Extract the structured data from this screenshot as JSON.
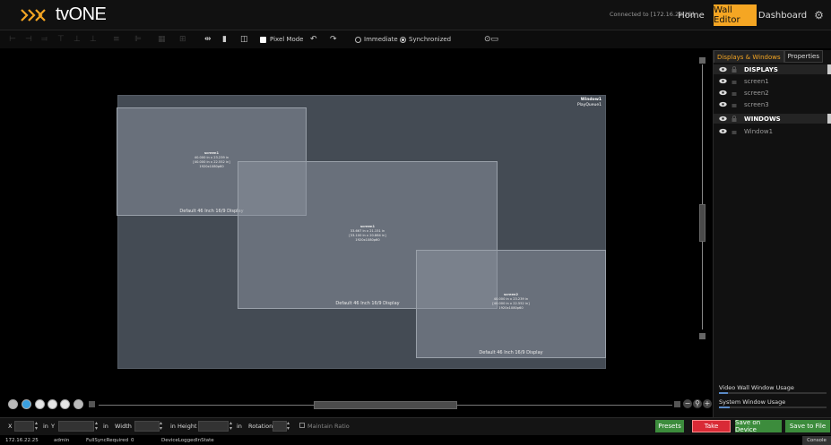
{
  "app": {
    "brand": "tvONE",
    "connection": "Connected to [172.16.22.25]"
  },
  "nav": {
    "home": "Home",
    "wall_editor": "Wall Editor",
    "dashboard": "Dashboard"
  },
  "toolbar": {
    "pixel_mode": "Pixel Mode",
    "immediate": "Immediate",
    "synchronized": "Synchronized",
    "selected_mode": "Synchronized"
  },
  "wall": {
    "window_title": "Window1",
    "window_sub": "PlayQueue1",
    "screens": [
      {
        "name": "screen1",
        "dims": "40.000 in x 23.239 in",
        "dims2": "[40.000 in x 22.552 in]",
        "res": "1920x1080p60",
        "footer": "Default 46 Inch 16/9 Display"
      },
      {
        "name": "screen1",
        "dims": "33.667 in x 21.151 in",
        "dims2": "[33.100 in x 20.864 in]",
        "res": "1920x1080p60",
        "footer": "Default 46 Inch 16/9 Display"
      },
      {
        "name": "screen2",
        "dims": "40.000 in x 23.239 in",
        "dims2": "[40.000 in x 22.552 in]",
        "res": "1920x1080p60",
        "footer": "Default 46 Inch 16/9 Display"
      }
    ]
  },
  "panel": {
    "tab_displays": "Displays & Windows",
    "tab_properties": "Properties",
    "items": [
      {
        "label": "DISPLAYS",
        "type": "group"
      },
      {
        "label": "screen1",
        "type": "child"
      },
      {
        "label": "screen2",
        "type": "child"
      },
      {
        "label": "screen3",
        "type": "child"
      },
      {
        "label": "WINDOWS",
        "type": "group"
      },
      {
        "label": "Window1",
        "type": "child"
      }
    ],
    "usage_video": "Video Wall Window Usage",
    "usage_system": "System Window Usage",
    "usage_video_fraction": 0.08,
    "usage_system_fraction": 0.1
  },
  "props": {
    "x_label": "X",
    "y_label": "Y",
    "unit": "in",
    "width_label": "Width",
    "height_label": "Height",
    "rotation_label": "Rotation",
    "maintain_ratio": "Maintain Ratio"
  },
  "buttons": {
    "presets": "Presets",
    "take": "Take",
    "save_device": "Save on Device",
    "save_file": "Save to File"
  },
  "status": {
    "ip": "172.16.22.25",
    "user": "admin",
    "sync": "FullSyncRequired",
    "sync_count": "0",
    "state": "DeviceLoggedInState",
    "console": "Console"
  },
  "colors": {
    "accent": "#f5a623",
    "take": "#d92a36",
    "save": "#3c8c3c"
  }
}
